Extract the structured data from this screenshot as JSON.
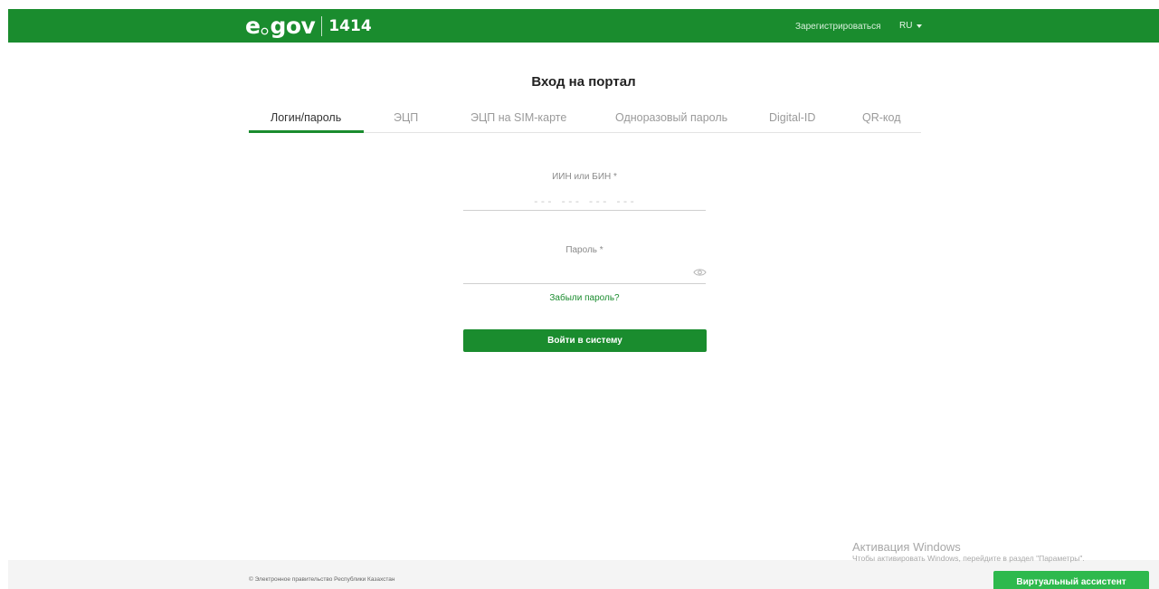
{
  "header": {
    "logo": {
      "e": "e",
      "gov": "gov",
      "number": "1414"
    },
    "register_link": "Зарегистрироваться",
    "language": "RU"
  },
  "page_title": "Вход на портал",
  "tabs": [
    {
      "label": "Логин/пароль",
      "active": true
    },
    {
      "label": "ЭЦП",
      "active": false
    },
    {
      "label": "ЭЦП на SIM-карте",
      "active": false
    },
    {
      "label": "Одноразовый пароль",
      "active": false
    },
    {
      "label": "Digital-ID",
      "active": false
    },
    {
      "label": "QR-код",
      "active": false
    }
  ],
  "form": {
    "iin_label": "ИИН или БИН *",
    "iin_placeholder": "--- --- --- ---",
    "iin_value": "",
    "password_label": "Пароль *",
    "password_value": "",
    "forgot_link": "Забыли пароль?",
    "submit_label": "Войти в систему"
  },
  "footer": {
    "copyright": "© Электронное правительство Республики Казахстан",
    "assistant_button": "Виртуальный ассистент"
  },
  "watermark": {
    "title": "Активация Windows",
    "subtitle": "Чтобы активировать Windows, перейдите в раздел \"Параметры\"."
  },
  "colors": {
    "brand_green": "#1a8c2e",
    "assistant_green": "#2eb94d",
    "footer_bg": "#f4f4f4"
  },
  "icons": {
    "password_toggle": "eye-icon",
    "language_dropdown": "caret-down-icon",
    "logo_mark": "globe-dot-icon"
  }
}
